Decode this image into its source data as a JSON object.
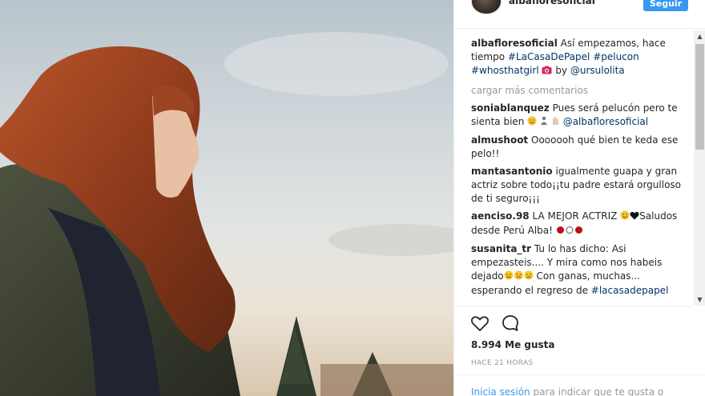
{
  "header": {
    "username": "albafloresoficial",
    "follow_label": "Seguir"
  },
  "caption": {
    "username": "albafloresoficial",
    "text": "Así empezamos, hace tiempo",
    "hashtag1": "#LaCasaDePapel",
    "hashtag2": "#pelucon",
    "hashtag3": "#whosthatgirl",
    "by_text": "by",
    "mention": "@ursulolita"
  },
  "load_more": "cargar más comentarios",
  "comments": [
    {
      "username": "soniablanquez",
      "text": "Pues será pelucón pero te sienta bien",
      "mention": "@albafloresoficial"
    },
    {
      "username": "almushoot",
      "text": "Ooooooh qué bien te keda ese pelo!!"
    },
    {
      "username": "mantasantonio",
      "text": "igualmente guapa y gran actriz sobre todo¡¡tu padre estará orgulloso de ti seguro¡¡¡"
    },
    {
      "username": "aenciso.98",
      "text_before": "LA MEJOR ACTRIZ",
      "text_after": "Saludos desde Perú Alba!"
    },
    {
      "username": "susanita_tr",
      "text": "Tu lo has dicho: Asi empezasteis.... Y mira como nos habeis dejado",
      "text_after": "Con ganas, muchas... esperando el regreso de",
      "hashtag": "#lacasadepapel"
    }
  ],
  "likes": "8.994 Me gusta",
  "timestamp": "HACE 21 HORAS",
  "login": {
    "link": "Inicia sesión",
    "text": "para indicar que te gusta o"
  },
  "icons": {
    "like": "heart-icon",
    "comment": "comment-bubble-icon",
    "camera": "camera-emoji-icon"
  },
  "colors": {
    "accent": "#3897f0",
    "hashtag": "#003569",
    "muted": "#999999"
  }
}
